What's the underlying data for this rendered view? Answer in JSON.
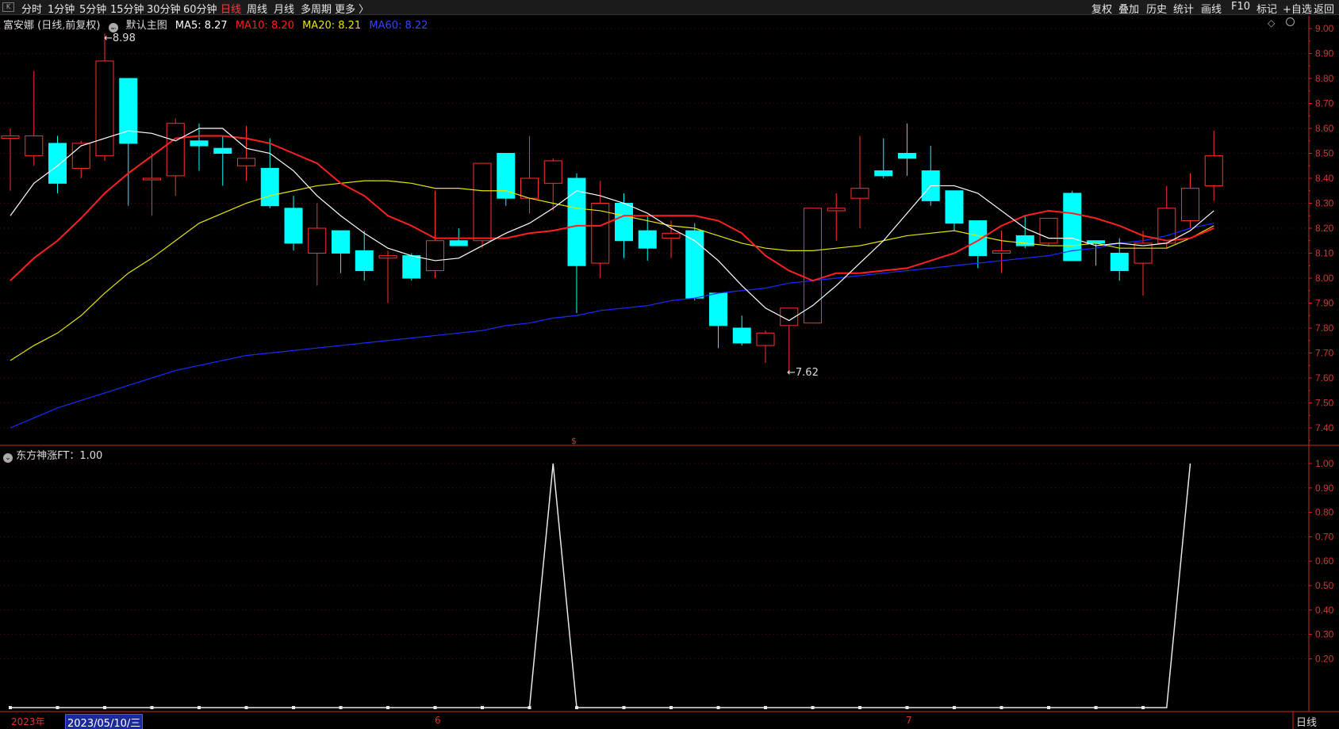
{
  "topbar": {
    "logo_text": "K",
    "periods": [
      "分时",
      "1分钟",
      "5分钟",
      "15分钟",
      "30分钟",
      "60分钟",
      "日线",
      "周线",
      "月线",
      "多周期",
      "更多 〉"
    ],
    "active_period": "日线",
    "tools": [
      "复权",
      "叠加",
      "历史",
      "统计",
      "画线",
      "F10",
      "标记",
      "+自选",
      "返回"
    ]
  },
  "main_legend": {
    "stock": "富安娜 (日线,前复权)",
    "template": "默认主图",
    "ma5": "MA5: 8.27",
    "ma10": "MA10: 8.20",
    "ma20": "MA20: 8.21",
    "ma60": "MA60: 8.22"
  },
  "sub_legend": "东方神涨FT：1.00",
  "high_label": "8.98",
  "low_label": "7.62",
  "dates": {
    "year": "2023年",
    "cursor": "2023/05/10/三",
    "month6": "6",
    "month7": "7"
  },
  "timeframe_label": "日线",
  "colors": {
    "up": "#ff3030",
    "down": "#00ffff",
    "ma5": "#ffffff",
    "ma10": "#ff2020",
    "ma20": "#e6e600",
    "ma60": "#1a2bff",
    "axis": "#d22"
  },
  "chart_data": [
    {
      "type": "candlestick",
      "title": "富安娜 (日线,前复权)",
      "y_ticks": [
        "9.00",
        "8.90",
        "8.80",
        "8.70",
        "8.60",
        "8.50",
        "8.40",
        "8.30",
        "8.20",
        "8.10",
        "8.00",
        "7.90",
        "7.80",
        "7.70",
        "7.60",
        "7.50",
        "7.40"
      ],
      "ylim": [
        7.35,
        9.02
      ],
      "candles": [
        {
          "o": 8.56,
          "h": 8.6,
          "l": 8.35,
          "c": 8.57
        },
        {
          "o": 8.49,
          "h": 8.83,
          "l": 8.45,
          "c": 8.57
        },
        {
          "o": 8.54,
          "h": 8.57,
          "l": 8.34,
          "c": 8.38
        },
        {
          "o": 8.44,
          "h": 8.55,
          "l": 8.4,
          "c": 8.54
        },
        {
          "o": 8.49,
          "h": 8.98,
          "l": 8.47,
          "c": 8.87
        },
        {
          "o": 8.8,
          "h": 8.8,
          "l": 8.29,
          "c": 8.54
        },
        {
          "o": 8.4,
          "h": 8.5,
          "l": 8.25,
          "c": 8.4
        },
        {
          "o": 8.41,
          "h": 8.64,
          "l": 8.33,
          "c": 8.62
        },
        {
          "o": 8.55,
          "h": 8.62,
          "l": 8.43,
          "c": 8.53
        },
        {
          "o": 8.52,
          "h": 8.57,
          "l": 8.37,
          "c": 8.5
        },
        {
          "o": 8.45,
          "h": 8.61,
          "l": 8.39,
          "c": 8.48
        },
        {
          "o": 8.44,
          "h": 8.56,
          "l": 8.28,
          "c": 8.29
        },
        {
          "o": 8.28,
          "h": 8.33,
          "l": 8.11,
          "c": 8.14
        },
        {
          "o": 8.1,
          "h": 8.3,
          "l": 7.97,
          "c": 8.2
        },
        {
          "o": 8.19,
          "h": 8.19,
          "l": 8.02,
          "c": 8.1
        },
        {
          "o": 8.11,
          "h": 8.19,
          "l": 7.99,
          "c": 8.03
        },
        {
          "o": 8.08,
          "h": 8.11,
          "l": 7.9,
          "c": 8.09
        },
        {
          "o": 8.09,
          "h": 8.1,
          "l": 7.99,
          "c": 8.0
        },
        {
          "o": 8.03,
          "h": 8.35,
          "l": 8.0,
          "c": 8.15
        },
        {
          "o": 8.15,
          "h": 8.2,
          "l": 8.13,
          "c": 8.13
        },
        {
          "o": 8.15,
          "h": 8.46,
          "l": 8.12,
          "c": 8.46
        },
        {
          "o": 8.5,
          "h": 8.5,
          "l": 8.29,
          "c": 8.32
        },
        {
          "o": 8.32,
          "h": 8.57,
          "l": 8.26,
          "c": 8.4
        },
        {
          "o": 8.38,
          "h": 8.48,
          "l": 8.27,
          "c": 8.47
        },
        {
          "o": 8.4,
          "h": 8.42,
          "l": 7.86,
          "c": 8.05
        },
        {
          "o": 8.06,
          "h": 8.39,
          "l": 8.0,
          "c": 8.3
        },
        {
          "o": 8.3,
          "h": 8.34,
          "l": 8.08,
          "c": 8.15
        },
        {
          "o": 8.19,
          "h": 8.25,
          "l": 8.07,
          "c": 8.12
        },
        {
          "o": 8.16,
          "h": 8.23,
          "l": 8.08,
          "c": 8.18
        },
        {
          "o": 8.19,
          "h": 8.22,
          "l": 7.91,
          "c": 7.92
        },
        {
          "o": 7.94,
          "h": 7.94,
          "l": 7.72,
          "c": 7.81
        },
        {
          "o": 7.8,
          "h": 7.85,
          "l": 7.73,
          "c": 7.74
        },
        {
          "o": 7.73,
          "h": 7.79,
          "l": 7.66,
          "c": 7.78
        },
        {
          "o": 7.81,
          "h": 7.88,
          "l": 7.62,
          "c": 7.88
        },
        {
          "o": 7.82,
          "h": 8.28,
          "l": 7.82,
          "c": 8.28
        },
        {
          "o": 8.27,
          "h": 8.34,
          "l": 8.15,
          "c": 8.28
        },
        {
          "o": 8.32,
          "h": 8.57,
          "l": 8.2,
          "c": 8.36
        },
        {
          "o": 8.43,
          "h": 8.56,
          "l": 8.4,
          "c": 8.41
        },
        {
          "o": 8.5,
          "h": 8.62,
          "l": 8.41,
          "c": 8.48
        },
        {
          "o": 8.43,
          "h": 8.53,
          "l": 8.29,
          "c": 8.31
        },
        {
          "o": 8.35,
          "h": 8.35,
          "l": 8.19,
          "c": 8.22
        },
        {
          "o": 8.23,
          "h": 8.23,
          "l": 8.04,
          "c": 8.09
        },
        {
          "o": 8.1,
          "h": 8.19,
          "l": 8.02,
          "c": 8.11
        },
        {
          "o": 8.17,
          "h": 8.25,
          "l": 8.12,
          "c": 8.13
        },
        {
          "o": 8.14,
          "h": 8.24,
          "l": 8.13,
          "c": 8.24
        },
        {
          "o": 8.34,
          "h": 8.35,
          "l": 8.07,
          "c": 8.07
        },
        {
          "o": 8.15,
          "h": 8.15,
          "l": 8.05,
          "c": 8.14
        },
        {
          "o": 8.1,
          "h": 8.16,
          "l": 7.99,
          "c": 8.03
        },
        {
          "o": 8.06,
          "h": 8.19,
          "l": 7.93,
          "c": 8.14
        },
        {
          "o": 8.14,
          "h": 8.37,
          "l": 8.12,
          "c": 8.28
        },
        {
          "o": 8.23,
          "h": 8.42,
          "l": 8.2,
          "c": 8.36
        },
        {
          "o": 8.37,
          "h": 8.59,
          "l": 8.31,
          "c": 8.49
        }
      ],
      "ma5": [
        8.25,
        8.38,
        8.45,
        8.53,
        8.56,
        8.59,
        8.58,
        8.55,
        8.6,
        8.6,
        8.52,
        8.5,
        8.43,
        8.33,
        8.25,
        8.18,
        8.12,
        8.09,
        8.07,
        8.08,
        8.13,
        8.18,
        8.22,
        8.28,
        8.35,
        8.33,
        8.3,
        8.26,
        8.2,
        8.15,
        8.07,
        7.97,
        7.88,
        7.83,
        7.89,
        7.97,
        8.06,
        8.15,
        8.26,
        8.37,
        8.37,
        8.34,
        8.27,
        8.2,
        8.16,
        8.16,
        8.13,
        8.14,
        8.13,
        8.14,
        8.19,
        8.27
      ],
      "ma10": [
        7.99,
        8.08,
        8.15,
        8.24,
        8.34,
        8.42,
        8.49,
        8.56,
        8.57,
        8.57,
        8.56,
        8.54,
        8.5,
        8.46,
        8.38,
        8.33,
        8.25,
        8.21,
        8.16,
        8.16,
        8.16,
        8.16,
        8.18,
        8.19,
        8.21,
        8.21,
        8.25,
        8.25,
        8.25,
        8.25,
        8.23,
        8.18,
        8.09,
        8.03,
        7.99,
        8.02,
        8.02,
        8.03,
        8.04,
        8.07,
        8.1,
        8.15,
        8.21,
        8.25,
        8.27,
        8.26,
        8.24,
        8.21,
        8.17,
        8.15,
        8.16,
        8.2
      ],
      "ma20": [
        7.67,
        7.73,
        7.78,
        7.85,
        7.94,
        8.02,
        8.08,
        8.15,
        8.22,
        8.26,
        8.3,
        8.33,
        8.35,
        8.37,
        8.38,
        8.39,
        8.39,
        8.38,
        8.36,
        8.36,
        8.35,
        8.35,
        8.32,
        8.3,
        8.28,
        8.27,
        8.25,
        8.23,
        8.21,
        8.2,
        8.17,
        8.14,
        8.12,
        8.11,
        8.11,
        8.12,
        8.13,
        8.15,
        8.17,
        8.18,
        8.19,
        8.17,
        8.15,
        8.14,
        8.13,
        8.13,
        8.14,
        8.12,
        8.12,
        8.12,
        8.16,
        8.21
      ],
      "ma60": [
        7.4,
        7.44,
        7.48,
        7.51,
        7.54,
        7.57,
        7.6,
        7.63,
        7.65,
        7.67,
        7.69,
        7.7,
        7.71,
        7.72,
        7.73,
        7.74,
        7.75,
        7.76,
        7.77,
        7.78,
        7.79,
        7.81,
        7.82,
        7.84,
        7.85,
        7.87,
        7.88,
        7.89,
        7.91,
        7.92,
        7.94,
        7.95,
        7.96,
        7.98,
        7.99,
        8.0,
        8.01,
        8.02,
        8.03,
        8.04,
        8.05,
        8.06,
        8.07,
        8.08,
        8.09,
        8.11,
        8.12,
        8.14,
        8.15,
        8.17,
        8.2,
        8.22
      ]
    },
    {
      "type": "line",
      "title": "东方神涨FT",
      "y_ticks": [
        "1.00",
        "0.90",
        "0.80",
        "0.70",
        "0.60",
        "0.50",
        "0.40",
        "0.30",
        "0.20"
      ],
      "ylim": [
        0,
        1.0
      ],
      "values": [
        0,
        0,
        0,
        0,
        0,
        0,
        0,
        0,
        0,
        0,
        0,
        0,
        0,
        0,
        0,
        0,
        0,
        0,
        0,
        0,
        0,
        0,
        0,
        1,
        0,
        0,
        0,
        0,
        0,
        0,
        0,
        0,
        0,
        0,
        0,
        0,
        0,
        0,
        0,
        0,
        0,
        0,
        0,
        0,
        0,
        0,
        0,
        0,
        0,
        0,
        1
      ]
    }
  ]
}
